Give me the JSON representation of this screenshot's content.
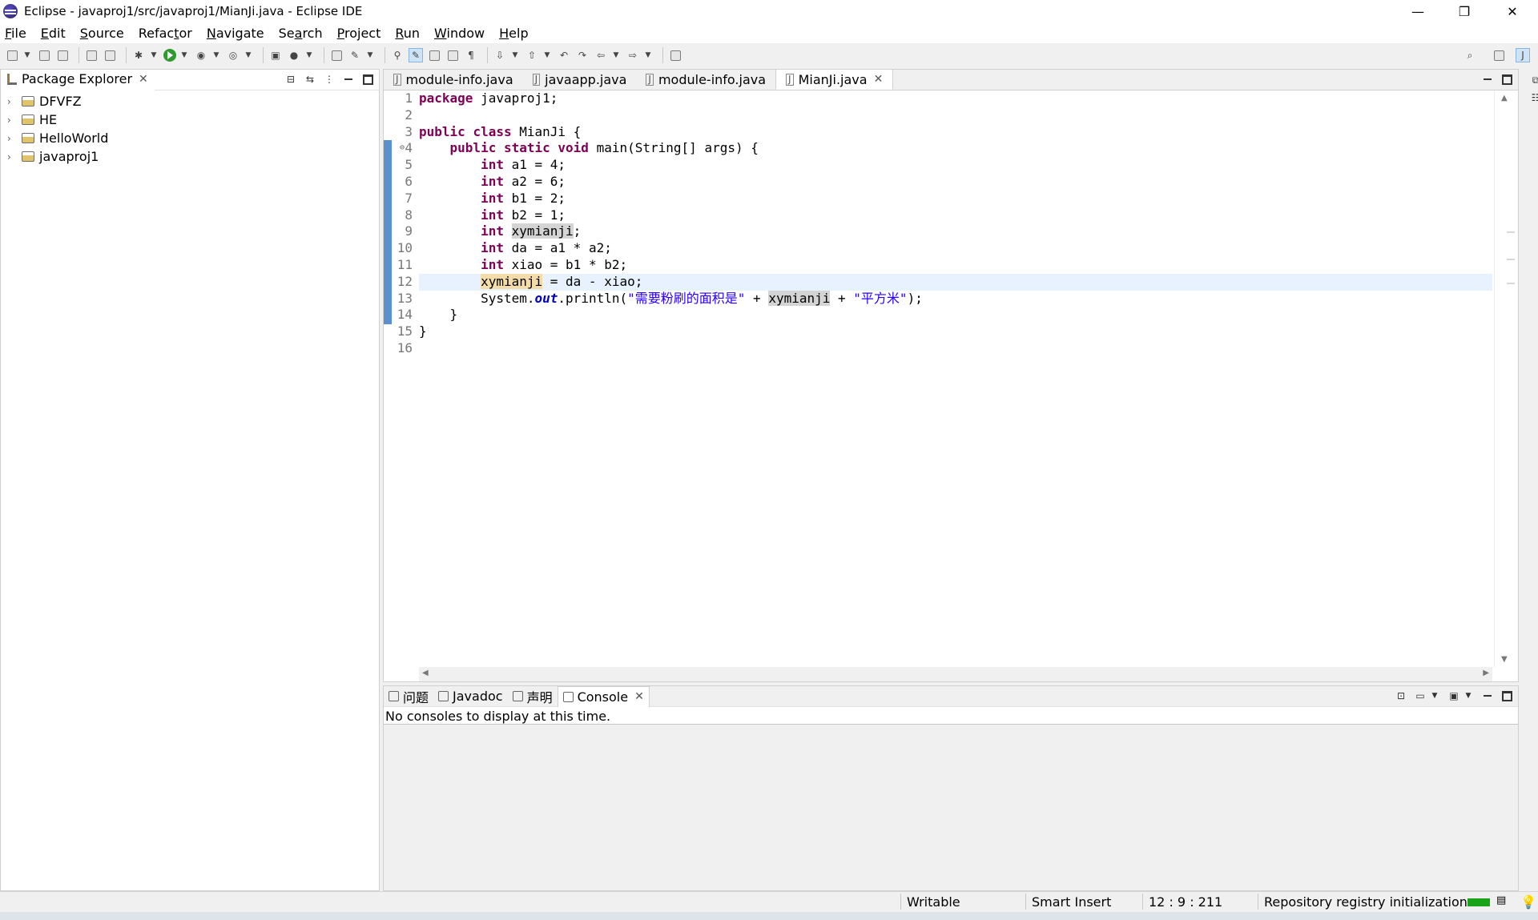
{
  "window": {
    "title": "Eclipse - javaproj1/src/javaproj1/MianJi.java - Eclipse IDE",
    "minimize": "—",
    "restore": "❐",
    "close": "✕"
  },
  "menu": [
    {
      "u": "F",
      "rest": "ile"
    },
    {
      "u": "E",
      "rest": "dit"
    },
    {
      "u": "S",
      "rest": "ource"
    },
    {
      "pre": "Refac",
      "u": "t",
      "rest": "or"
    },
    {
      "u": "N",
      "rest": "avigate"
    },
    {
      "pre": "Se",
      "u": "a",
      "rest": "rch"
    },
    {
      "u": "P",
      "rest": "roject"
    },
    {
      "u": "R",
      "rest": "un"
    },
    {
      "u": "W",
      "rest": "indow"
    },
    {
      "u": "H",
      "rest": "elp"
    }
  ],
  "package_explorer": {
    "tab_label": "Package Explorer",
    "projects": [
      "DFVFZ",
      "HE",
      "HelloWorld",
      "javaproj1"
    ]
  },
  "editor": {
    "tabs": [
      {
        "label": "module-info.java",
        "active": false
      },
      {
        "label": "javaapp.java",
        "active": false
      },
      {
        "label": "module-info.java",
        "active": false
      },
      {
        "label": "MianJi.java",
        "active": true
      }
    ],
    "line_numbers": [
      "1",
      "2",
      "3",
      "4",
      "5",
      "6",
      "7",
      "8",
      "9",
      "10",
      "11",
      "12",
      "13",
      "14",
      "15",
      "16"
    ],
    "code_lines": [
      "package javaproj1;",
      "",
      "public class MianJi {",
      "    public static void main(String[] args) {",
      "        int a1 = 4;",
      "        int a2 = 6;",
      "        int b1 = 2;",
      "        int b2 = 1;",
      "        int xymianji;",
      "        int da = a1 * a2;",
      "        int xiao = b1 * b2;",
      "        xymianji = da - xiao;",
      "        System.out.println(\"需要粉刷的面积是\" + xymianji + \"平方米\");",
      "    }",
      "}",
      ""
    ],
    "current_line": 12
  },
  "console": {
    "tabs": [
      {
        "label": "问题",
        "icon": "problems-icon"
      },
      {
        "label": "Javadoc",
        "icon": "javadoc-icon"
      },
      {
        "label": "声明",
        "icon": "declaration-icon"
      },
      {
        "label": "Console",
        "icon": "console-icon",
        "active": true
      }
    ],
    "message": "No consoles to display at this time."
  },
  "status": {
    "writable": "Writable",
    "insert_mode": "Smart Insert",
    "position": "12 : 9 : 211",
    "task": "Repository registry initialization"
  },
  "colors": {
    "keyword": "#7f0055",
    "string": "#2a00ff",
    "field": "#0000c0",
    "current_line": "#e8f2fe",
    "change_marker": "#5a8fd0"
  }
}
